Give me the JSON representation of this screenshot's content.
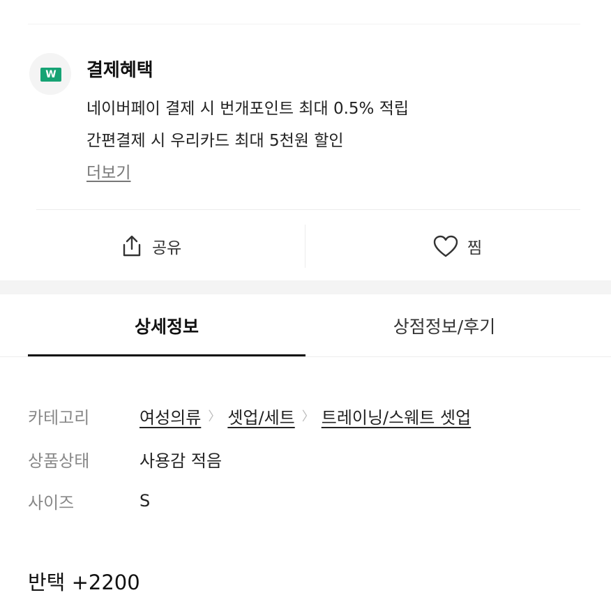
{
  "payment_benefit": {
    "icon": "naver-pay-w-icon",
    "icon_glyph": "W",
    "icon_color": "#16a374",
    "title": "결제혜택",
    "lines": [
      "네이버페이 결제 시 번개포인트 최대 0.5% 적립",
      "간편결제 시 우리카드 최대 5천원 할인"
    ],
    "more_label": "더보기"
  },
  "actions": {
    "share": {
      "icon": "share-upload-icon",
      "label": "공유"
    },
    "like": {
      "icon": "heart-outline-icon",
      "label": "찜"
    }
  },
  "tabs": [
    {
      "label": "상세정보",
      "active": true
    },
    {
      "label": "상점정보/후기",
      "active": false
    }
  ],
  "product_info": {
    "category": {
      "label": "카테고리",
      "path": [
        "여성의류",
        "셋업/세트",
        "트레이닝/스웨트 셋업"
      ]
    },
    "condition": {
      "label": "상품상태",
      "value": "사용감 적음"
    },
    "size": {
      "label": "사이즈",
      "value": "S"
    }
  },
  "description": {
    "text": "반택 +2200"
  }
}
